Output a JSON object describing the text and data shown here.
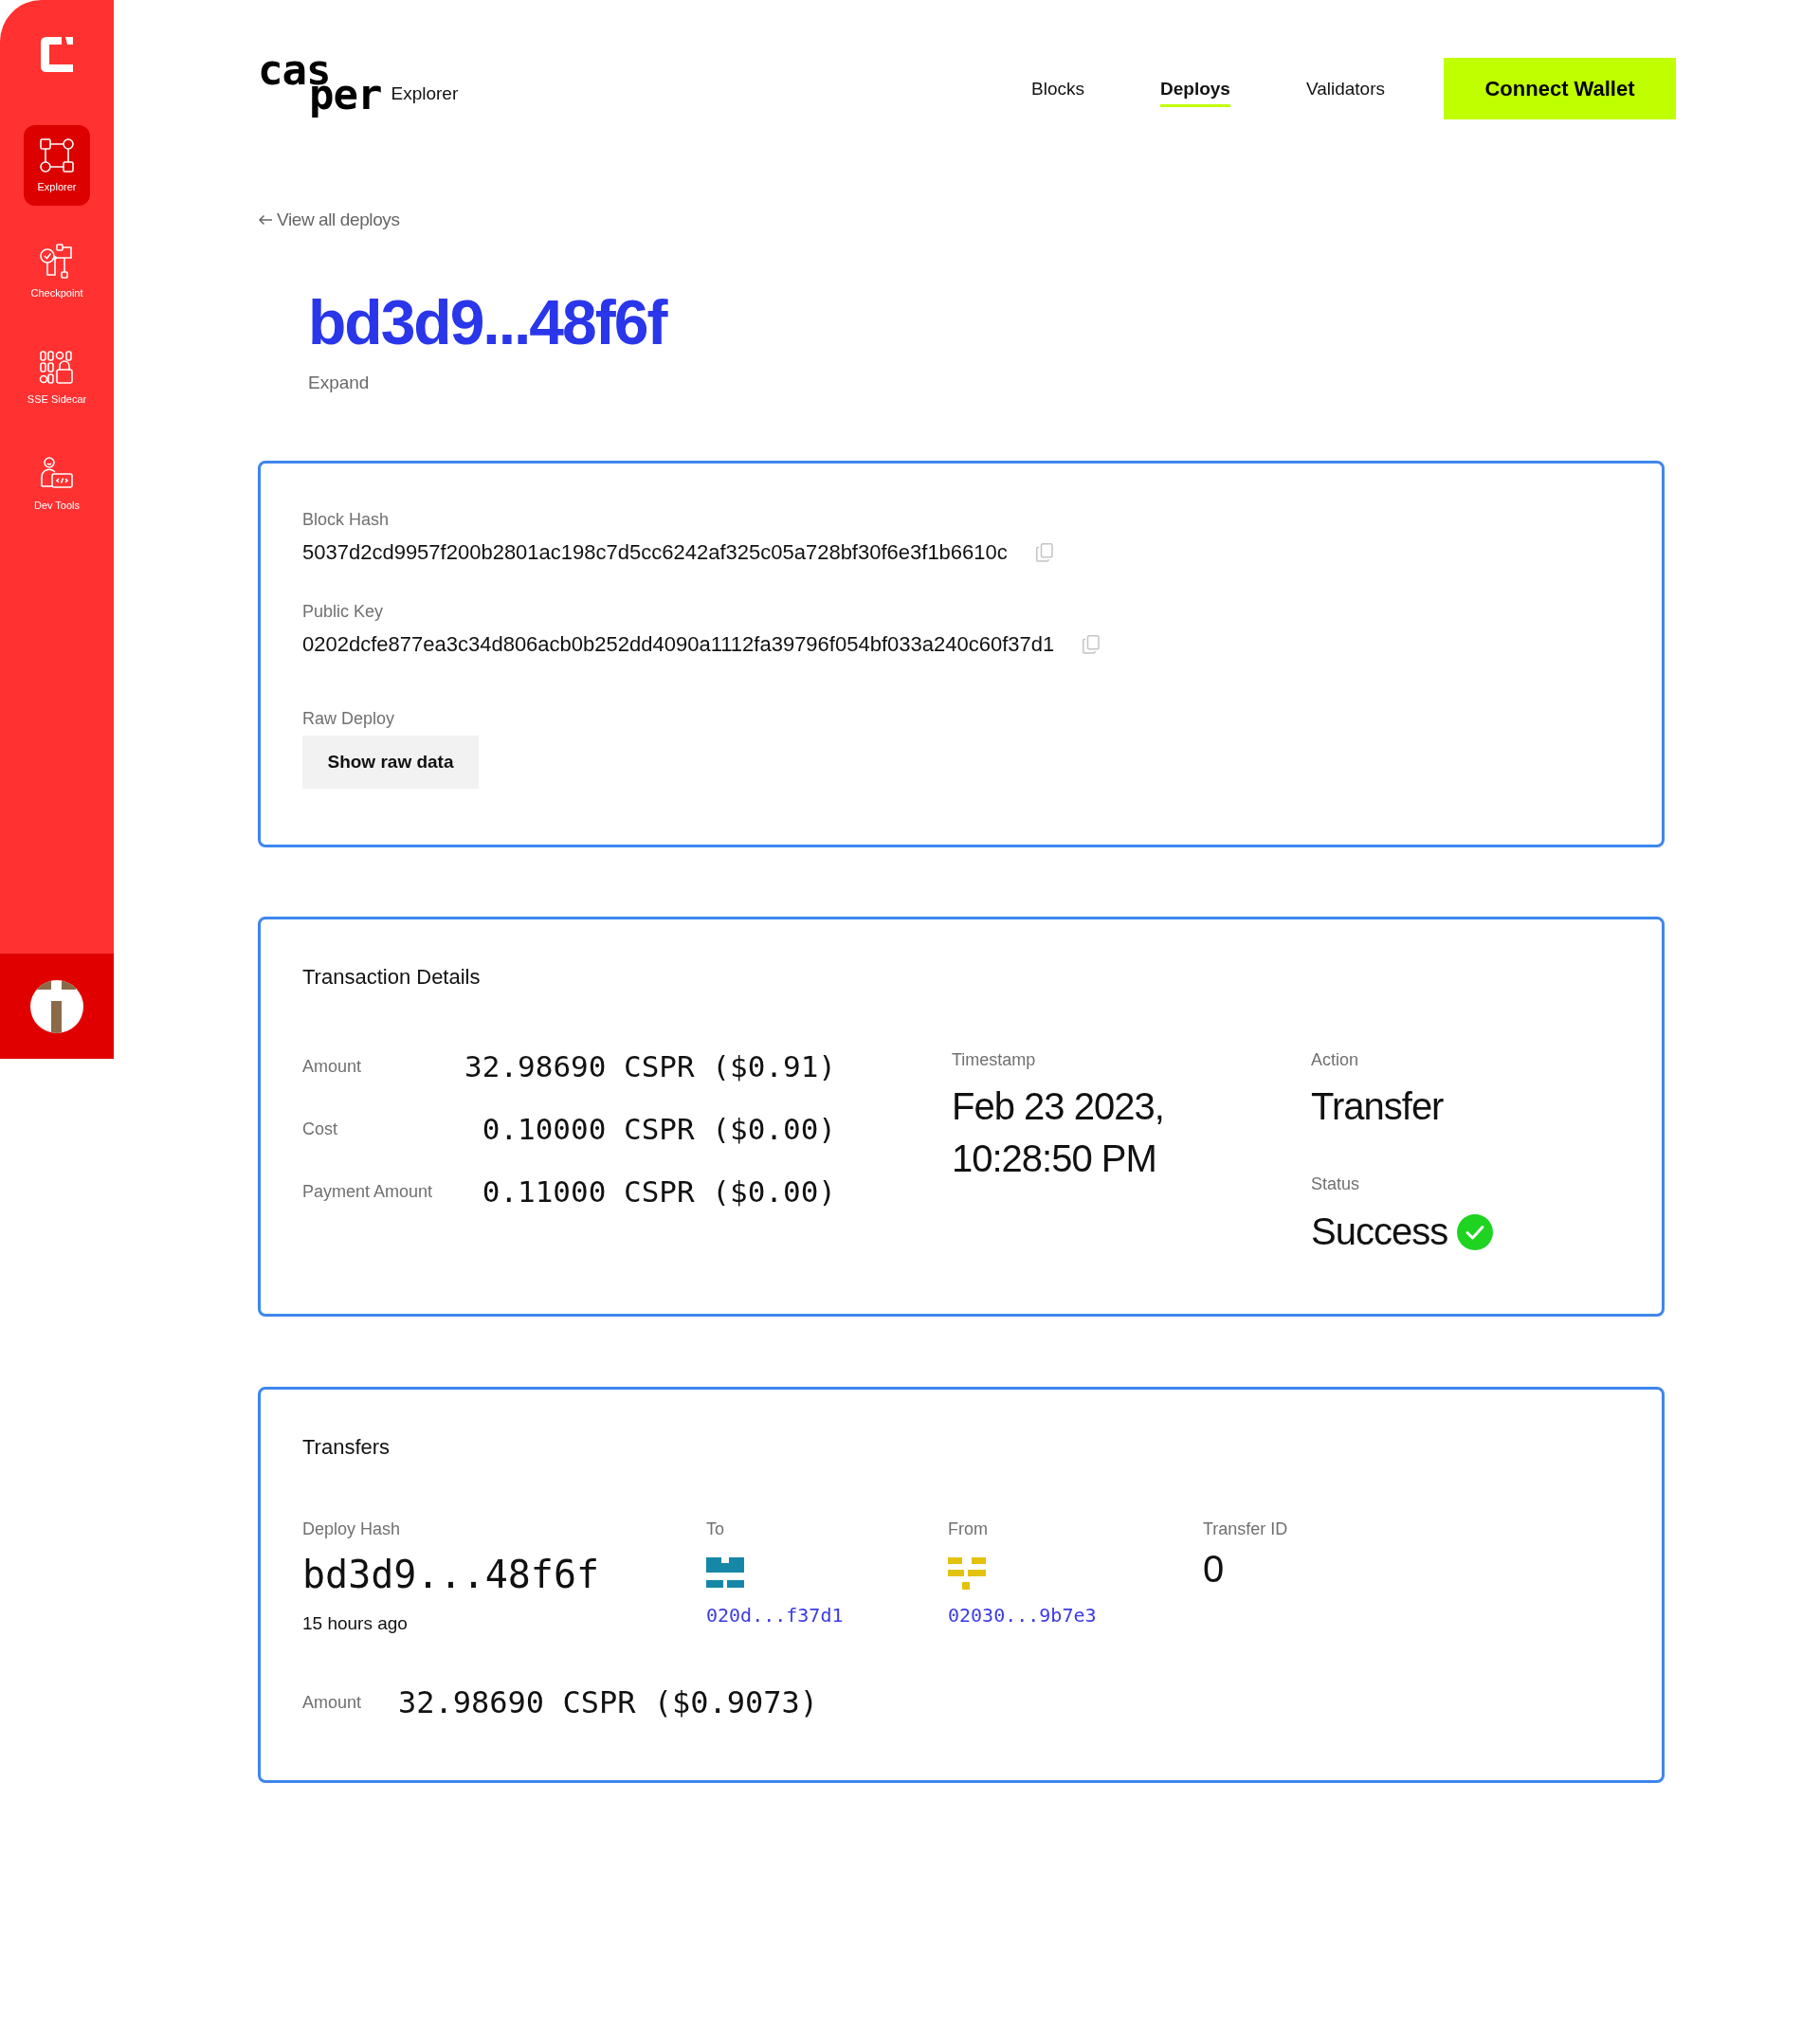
{
  "sidebar": {
    "items": [
      {
        "label": "Explorer",
        "selected": true
      },
      {
        "label": "Checkpoint",
        "selected": false
      },
      {
        "label": "SSE Sidecar",
        "selected": false
      },
      {
        "label": "Dev Tools",
        "selected": false
      }
    ]
  },
  "header": {
    "logo": {
      "wordmark": [
        "cas",
        "per"
      ],
      "product": "Explorer"
    },
    "nav": [
      {
        "label": "Blocks",
        "selected": false
      },
      {
        "label": "Deploys",
        "selected": true
      },
      {
        "label": "Validators",
        "selected": false
      }
    ],
    "connect_button": "Connect Wallet"
  },
  "back_link": "View all deploys",
  "deploy": {
    "hash": "bd3d9...48f6f",
    "expand": "Expand"
  },
  "info_card": {
    "fields": [
      {
        "label": "Block Hash",
        "value": "5037d2cd9957f200b2801ac198c7d5cc6242af325c05a728bf30f6e3f1b6610c"
      },
      {
        "label": "Public Key",
        "value": "0202dcfe877ea3c34d806acb0b252dd4090a1112fa39796f054bf033a240c60f37d1"
      }
    ],
    "raw_deploy": {
      "label": "Raw Deploy",
      "button": "Show raw data"
    }
  },
  "transaction": {
    "title": "Transaction Details",
    "amounts": [
      {
        "label": "Amount",
        "value": "32.98690 CSPR ($0.91)"
      },
      {
        "label": "Cost",
        "value": "0.10000 CSPR ($0.00)"
      },
      {
        "label": "Payment Amount",
        "value": "0.11000 CSPR ($0.00)"
      }
    ],
    "timestamp": {
      "label": "Timestamp",
      "value": "Feb 23 2023, 10:28:50 PM"
    },
    "action": {
      "label": "Action",
      "value": "Transfer"
    },
    "status": {
      "label": "Status",
      "value": "Success",
      "ok": true
    }
  },
  "transfer": {
    "title": "Transfers",
    "deploy_hash": {
      "label": "Deploy Hash",
      "value": "bd3d9...48f6f",
      "age": "15 hours ago"
    },
    "parties": [
      {
        "label": "To",
        "address": "020d...f37d1",
        "color": "#1687a7"
      },
      {
        "label": "From",
        "address": "02030...9b7e3",
        "color": "#e2c20c"
      }
    ],
    "transfer_id": {
      "label": "Transfer ID",
      "value": "0"
    },
    "amount": {
      "label": "Amount",
      "value": "32.98690 CSPR ($0.9073)"
    }
  }
}
